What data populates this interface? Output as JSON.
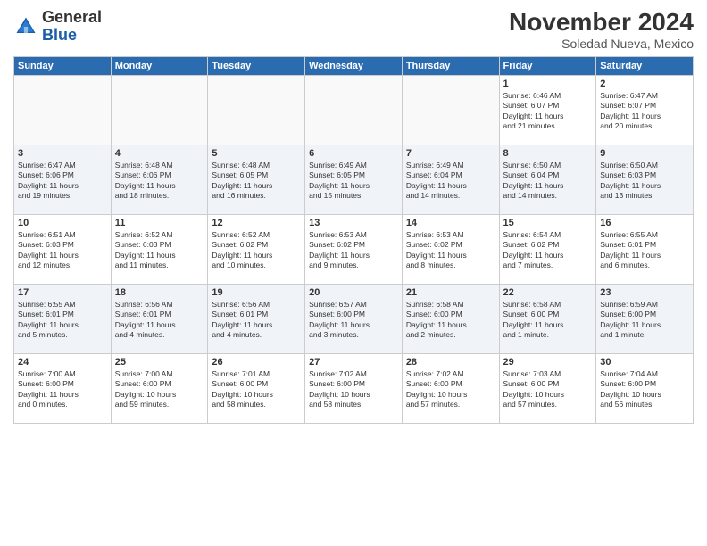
{
  "logo": {
    "general": "General",
    "blue": "Blue"
  },
  "header": {
    "month": "November 2024",
    "location": "Soledad Nueva, Mexico"
  },
  "weekdays": [
    "Sunday",
    "Monday",
    "Tuesday",
    "Wednesday",
    "Thursday",
    "Friday",
    "Saturday"
  ],
  "weeks": [
    [
      {
        "day": "",
        "info": ""
      },
      {
        "day": "",
        "info": ""
      },
      {
        "day": "",
        "info": ""
      },
      {
        "day": "",
        "info": ""
      },
      {
        "day": "",
        "info": ""
      },
      {
        "day": "1",
        "info": "Sunrise: 6:46 AM\nSunset: 6:07 PM\nDaylight: 11 hours\nand 21 minutes."
      },
      {
        "day": "2",
        "info": "Sunrise: 6:47 AM\nSunset: 6:07 PM\nDaylight: 11 hours\nand 20 minutes."
      }
    ],
    [
      {
        "day": "3",
        "info": "Sunrise: 6:47 AM\nSunset: 6:06 PM\nDaylight: 11 hours\nand 19 minutes."
      },
      {
        "day": "4",
        "info": "Sunrise: 6:48 AM\nSunset: 6:06 PM\nDaylight: 11 hours\nand 18 minutes."
      },
      {
        "day": "5",
        "info": "Sunrise: 6:48 AM\nSunset: 6:05 PM\nDaylight: 11 hours\nand 16 minutes."
      },
      {
        "day": "6",
        "info": "Sunrise: 6:49 AM\nSunset: 6:05 PM\nDaylight: 11 hours\nand 15 minutes."
      },
      {
        "day": "7",
        "info": "Sunrise: 6:49 AM\nSunset: 6:04 PM\nDaylight: 11 hours\nand 14 minutes."
      },
      {
        "day": "8",
        "info": "Sunrise: 6:50 AM\nSunset: 6:04 PM\nDaylight: 11 hours\nand 14 minutes."
      },
      {
        "day": "9",
        "info": "Sunrise: 6:50 AM\nSunset: 6:03 PM\nDaylight: 11 hours\nand 13 minutes."
      }
    ],
    [
      {
        "day": "10",
        "info": "Sunrise: 6:51 AM\nSunset: 6:03 PM\nDaylight: 11 hours\nand 12 minutes."
      },
      {
        "day": "11",
        "info": "Sunrise: 6:52 AM\nSunset: 6:03 PM\nDaylight: 11 hours\nand 11 minutes."
      },
      {
        "day": "12",
        "info": "Sunrise: 6:52 AM\nSunset: 6:02 PM\nDaylight: 11 hours\nand 10 minutes."
      },
      {
        "day": "13",
        "info": "Sunrise: 6:53 AM\nSunset: 6:02 PM\nDaylight: 11 hours\nand 9 minutes."
      },
      {
        "day": "14",
        "info": "Sunrise: 6:53 AM\nSunset: 6:02 PM\nDaylight: 11 hours\nand 8 minutes."
      },
      {
        "day": "15",
        "info": "Sunrise: 6:54 AM\nSunset: 6:02 PM\nDaylight: 11 hours\nand 7 minutes."
      },
      {
        "day": "16",
        "info": "Sunrise: 6:55 AM\nSunset: 6:01 PM\nDaylight: 11 hours\nand 6 minutes."
      }
    ],
    [
      {
        "day": "17",
        "info": "Sunrise: 6:55 AM\nSunset: 6:01 PM\nDaylight: 11 hours\nand 5 minutes."
      },
      {
        "day": "18",
        "info": "Sunrise: 6:56 AM\nSunset: 6:01 PM\nDaylight: 11 hours\nand 4 minutes."
      },
      {
        "day": "19",
        "info": "Sunrise: 6:56 AM\nSunset: 6:01 PM\nDaylight: 11 hours\nand 4 minutes."
      },
      {
        "day": "20",
        "info": "Sunrise: 6:57 AM\nSunset: 6:00 PM\nDaylight: 11 hours\nand 3 minutes."
      },
      {
        "day": "21",
        "info": "Sunrise: 6:58 AM\nSunset: 6:00 PM\nDaylight: 11 hours\nand 2 minutes."
      },
      {
        "day": "22",
        "info": "Sunrise: 6:58 AM\nSunset: 6:00 PM\nDaylight: 11 hours\nand 1 minute."
      },
      {
        "day": "23",
        "info": "Sunrise: 6:59 AM\nSunset: 6:00 PM\nDaylight: 11 hours\nand 1 minute."
      }
    ],
    [
      {
        "day": "24",
        "info": "Sunrise: 7:00 AM\nSunset: 6:00 PM\nDaylight: 11 hours\nand 0 minutes."
      },
      {
        "day": "25",
        "info": "Sunrise: 7:00 AM\nSunset: 6:00 PM\nDaylight: 10 hours\nand 59 minutes."
      },
      {
        "day": "26",
        "info": "Sunrise: 7:01 AM\nSunset: 6:00 PM\nDaylight: 10 hours\nand 58 minutes."
      },
      {
        "day": "27",
        "info": "Sunrise: 7:02 AM\nSunset: 6:00 PM\nDaylight: 10 hours\nand 58 minutes."
      },
      {
        "day": "28",
        "info": "Sunrise: 7:02 AM\nSunset: 6:00 PM\nDaylight: 10 hours\nand 57 minutes."
      },
      {
        "day": "29",
        "info": "Sunrise: 7:03 AM\nSunset: 6:00 PM\nDaylight: 10 hours\nand 57 minutes."
      },
      {
        "day": "30",
        "info": "Sunrise: 7:04 AM\nSunset: 6:00 PM\nDaylight: 10 hours\nand 56 minutes."
      }
    ]
  ]
}
